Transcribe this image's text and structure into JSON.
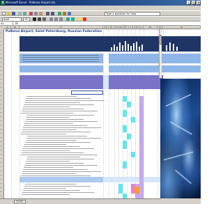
{
  "window": {
    "app_icon": "excel-icon",
    "title": "Microsoft Excel - Pulkovo Airport.xls"
  },
  "menu": {
    "items": [
      "File",
      "Edit",
      "View",
      "Insert",
      "Format",
      "Tools",
      "Data",
      "Window",
      "Help",
      "Adobe PDF"
    ]
  },
  "toolbar": {
    "font_name": "Arial",
    "font_size": "10",
    "help_placeholder": "Type a question for help"
  },
  "formula_bar": {
    "name_box": "A1",
    "formula": ""
  },
  "sheet": {
    "title": "Pulkovo Airport, Saint Petersburg, Russian Federation",
    "columns": [
      "A",
      "B",
      "C",
      "D",
      "E",
      "F",
      "G",
      "H",
      "I",
      "J",
      "K",
      "L",
      "M",
      "N",
      "O"
    ]
  },
  "tabs": [
    "Sheet1"
  ],
  "colors": {
    "header_navy": "#1f3566",
    "band_blue": "#8fb6e8",
    "cyan": "#5fe6f0",
    "purple": "#c7a6f2",
    "pink": "#f07ec8",
    "orange": "#f6a21a"
  }
}
